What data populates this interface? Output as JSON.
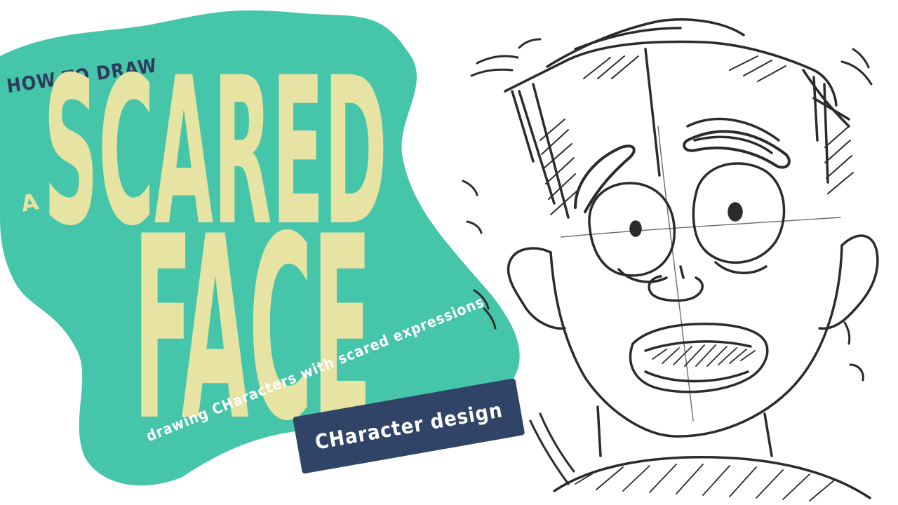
{
  "thumbnail": {
    "kicker": "HOW TO DRAW",
    "article": "A",
    "title_line1": "SCARED",
    "title_line2": "FACE",
    "tagline": "drawing CHaracters with scared expressions",
    "badge_label": "CHaracter design"
  },
  "colors": {
    "blob": "#45c5a9",
    "title": "#e6e3a3",
    "kicker": "#2d3b5e",
    "badge": "#2f4467",
    "badge_text": "#ffffff",
    "tagline": "#ffffff",
    "sketch_stroke": "#2b2b2b"
  },
  "illustration": {
    "subject": "pencil-sketch-scared-boy"
  }
}
